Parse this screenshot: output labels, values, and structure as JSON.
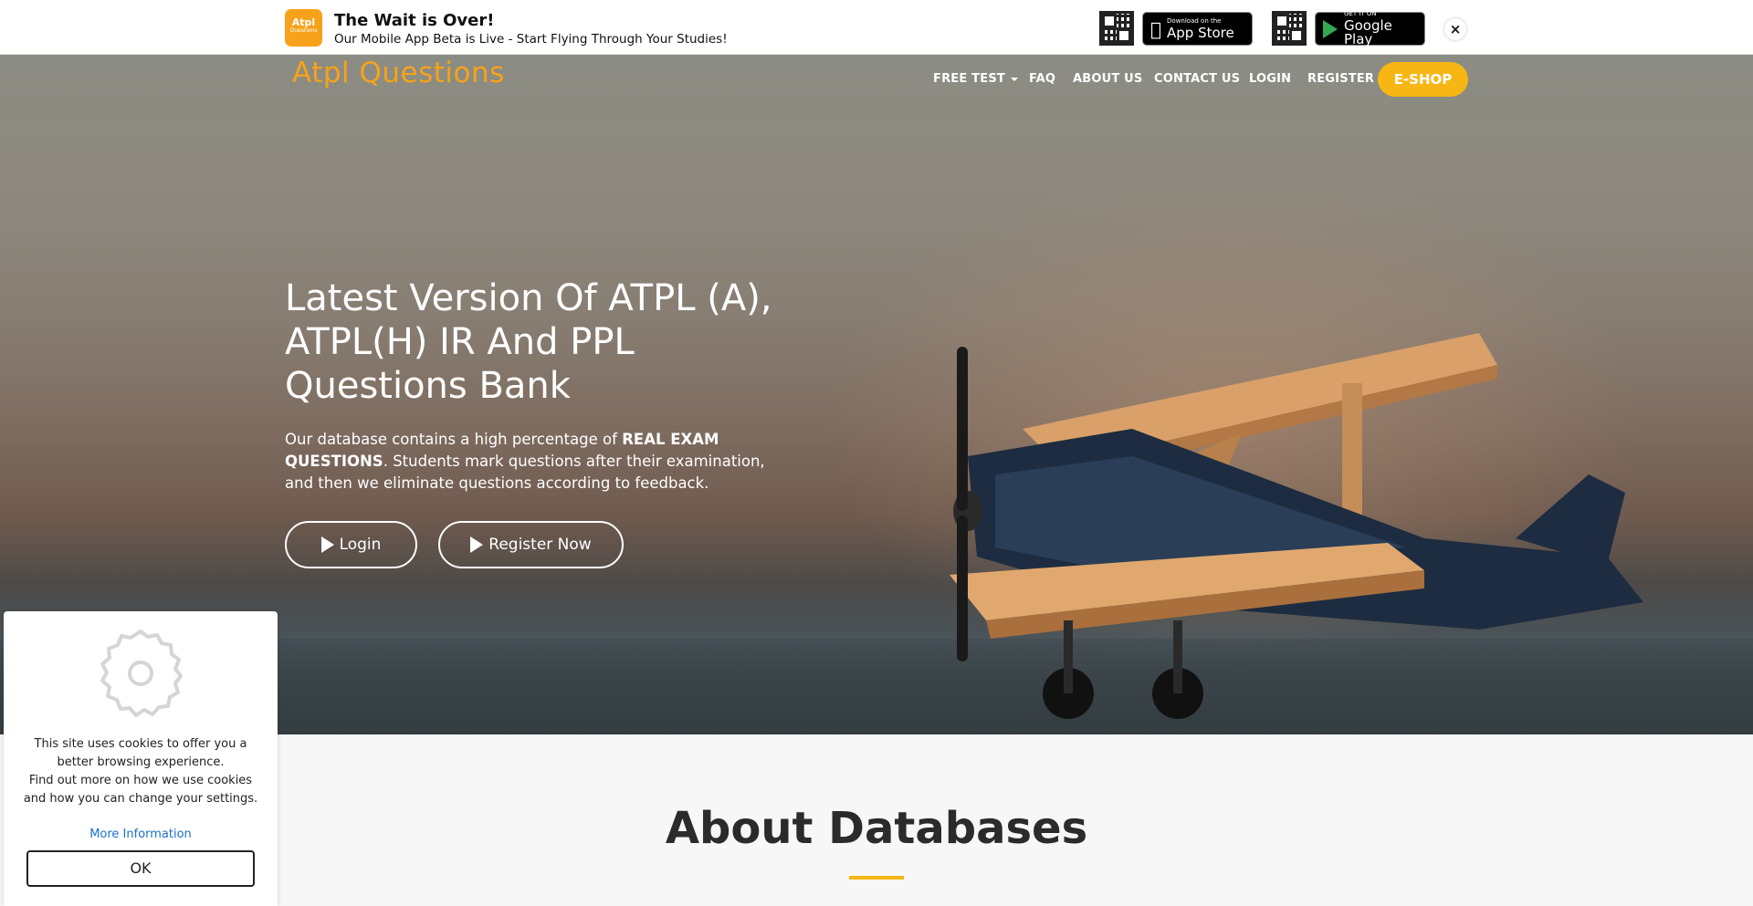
{
  "banner": {
    "logo_text": "Atpl",
    "logo_sub": "Questions",
    "title": "The Wait is Over!",
    "subtitle": "Our Mobile App Beta is Live - Start Flying Through Your Studies!",
    "appstore_small": "Download on the",
    "appstore_big": "App Store",
    "googleplay_small": "GET IT ON",
    "googleplay_big": "Google Play",
    "close_label": "×"
  },
  "nav": {
    "logo": "Atpl Questions",
    "items": [
      "FREE TEST",
      "FAQ",
      "ABOUT US",
      "CONTACT US",
      "LOGIN",
      "REGISTER"
    ],
    "eshop": "E-SHOP"
  },
  "hero": {
    "title": "Latest Version Of ATPL (A), ATPL(H) IR And PPL Questions Bank",
    "text_before": "Our database contains a high percentage of ",
    "text_bold": "REAL EXAM QUESTIONS",
    "text_after": ". Students mark questions after their examination, and then we eliminate questions according to feedback.",
    "login_label": "Login",
    "register_label": "Register Now"
  },
  "about": {
    "title": "About Databases"
  },
  "cookie": {
    "line1": "This site uses cookies to offer you a better browsing experience.",
    "line2": "Find out more on how we use cookies and how you can change your settings.",
    "more": "More Information",
    "ok": "OK"
  },
  "colors": {
    "accent": "#f7b614",
    "logo_orange": "#f7a21a",
    "link_blue": "#1a6fc9"
  }
}
